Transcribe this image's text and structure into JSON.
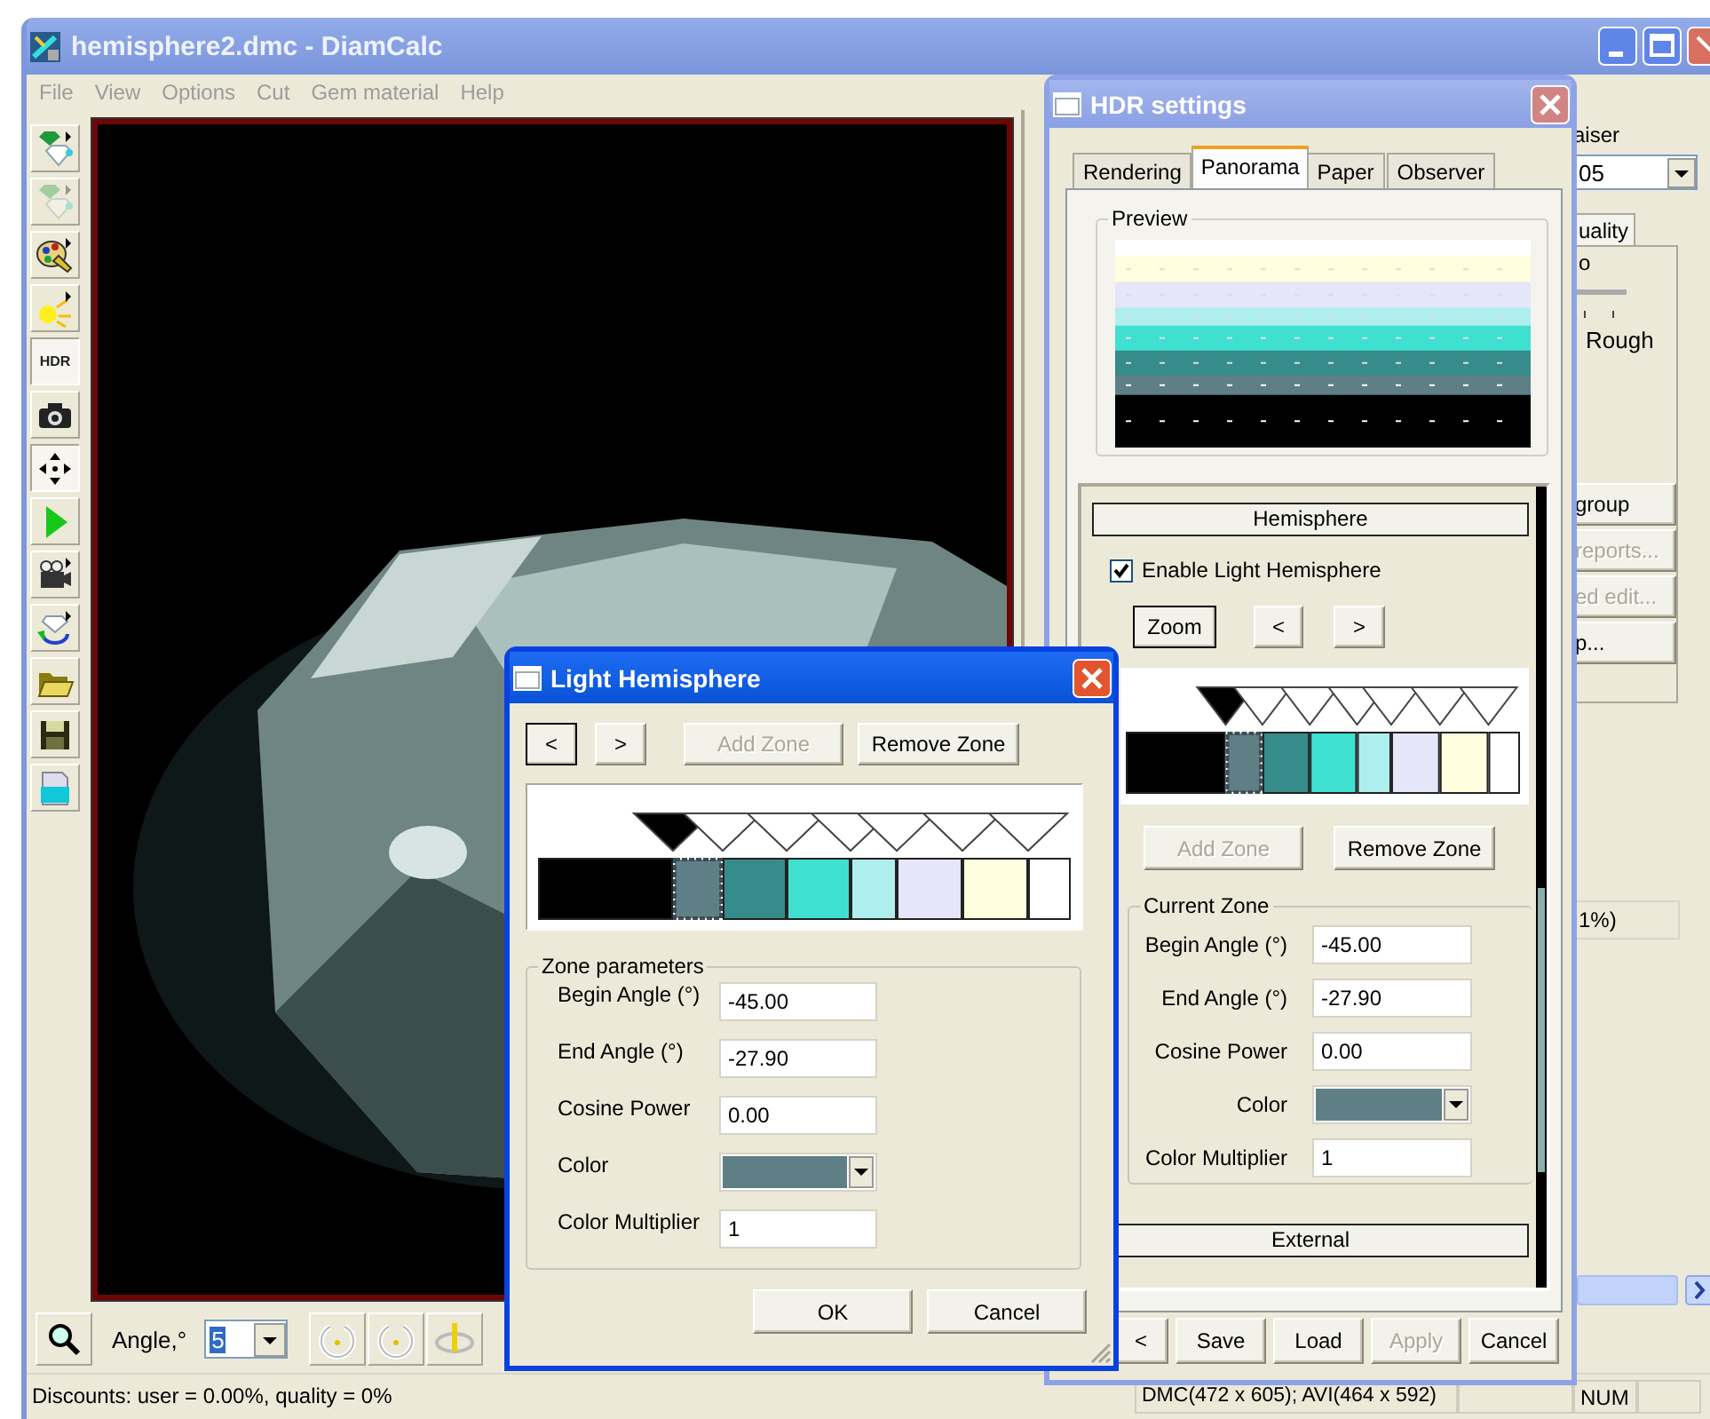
{
  "window": {
    "title": "hemisphere2.dmc - DiamCalc"
  },
  "menu": [
    "File",
    "View",
    "Options",
    "Cut",
    "Gem material",
    "Help"
  ],
  "toolbar": [
    {
      "kind": "gem",
      "pressed": false,
      "disabled": false
    },
    {
      "kind": "gem",
      "pressed": false,
      "disabled": true
    },
    {
      "kind": "palette",
      "pressed": false,
      "disabled": false
    },
    {
      "kind": "lamp",
      "pressed": false,
      "disabled": false
    },
    {
      "kind": "text",
      "label": "HDR",
      "pressed": true,
      "disabled": false
    },
    {
      "kind": "camera",
      "pressed": false,
      "disabled": false
    },
    {
      "kind": "move",
      "pressed": true,
      "disabled": false
    },
    {
      "kind": "play",
      "pressed": false,
      "disabled": false
    },
    {
      "kind": "video",
      "pressed": false,
      "disabled": false
    },
    {
      "kind": "rotate",
      "pressed": false,
      "disabled": false
    },
    {
      "kind": "folder",
      "pressed": false,
      "disabled": false
    },
    {
      "kind": "save",
      "pressed": false,
      "disabled": false
    },
    {
      "kind": "document",
      "pressed": false,
      "disabled": false
    }
  ],
  "side_panel": {
    "label": "aiser",
    "combo_value": "05",
    "tab": {
      "label": "uality",
      "selected": true
    },
    "text": "o",
    "slider_label": "Rough",
    "buttons": [
      {
        "label": "group",
        "disabled": false
      },
      {
        "label": "reports...",
        "disabled": true
      },
      {
        "label": "ed edit...",
        "disabled": true
      },
      {
        "label": "p...",
        "disabled": false
      }
    ],
    "reading": "1%)"
  },
  "bottom_toolbar": {
    "angle_label": "Angle,°",
    "angle_value": "5"
  },
  "status_bar": {
    "message": "Discounts: user = 0.00%, quality = 0%",
    "size": "DMC(472 x 605); AVI(464 x 592)",
    "num": "NUM"
  },
  "hdr_settings": {
    "title": "HDR settings",
    "tabs": [
      {
        "label": "Rendering",
        "selected": false
      },
      {
        "label": "Panorama",
        "selected": true
      },
      {
        "label": "Paper",
        "selected": false
      },
      {
        "label": "Observer",
        "selected": false
      }
    ],
    "preview_label": "Preview",
    "hemisphere_header": "Hemisphere",
    "enable_checkbox": {
      "label": "Enable Light Hemisphere",
      "checked": true
    },
    "zoom_button": "Zoom",
    "prev_button": "<",
    "next_button": ">",
    "zones": [
      {
        "color": "#000000",
        "selected": false
      },
      {
        "color": "#5f7f86",
        "selected": true
      },
      {
        "color": "#368c8b",
        "selected": false
      },
      {
        "color": "#40e0d0",
        "selected": false
      },
      {
        "color": "#afeeee",
        "selected": false
      },
      {
        "color": "#e6e6fa",
        "selected": false
      },
      {
        "color": "#ffffe0",
        "selected": false
      },
      {
        "color": "#ffffff",
        "selected": false
      }
    ],
    "add_zone": {
      "label": "Add Zone",
      "disabled": true
    },
    "remove_zone": {
      "label": "Remove Zone",
      "disabled": false
    },
    "current_zone": {
      "title": "Current Zone",
      "fields": [
        {
          "kind": "text",
          "label": "Begin Angle (°)",
          "value": "-45.00"
        },
        {
          "kind": "text",
          "label": "End Angle (°)",
          "value": "-27.90"
        },
        {
          "kind": "text",
          "label": "Cosine Power",
          "value": "0.00"
        },
        {
          "kind": "color",
          "label": "Color"
        },
        {
          "kind": "text",
          "label": "Color Multiplier",
          "value": "1"
        }
      ]
    },
    "external_header": "External",
    "buttons": [
      {
        "label": "<",
        "disabled": false
      },
      {
        "label": "Save",
        "disabled": false
      },
      {
        "label": "Load",
        "disabled": false
      },
      {
        "label": "Apply",
        "disabled": true
      },
      {
        "label": "Cancel",
        "disabled": false
      }
    ]
  },
  "light_hemisphere": {
    "title": "Light Hemisphere",
    "nav_buttons": [
      {
        "label": "<",
        "disabled": false
      },
      {
        "label": ">",
        "disabled": false
      }
    ],
    "add_zone": {
      "label": "Add Zone",
      "disabled": true
    },
    "remove_zone": {
      "label": "Remove Zone",
      "disabled": false
    },
    "zones": [
      {
        "color": "#000000",
        "selected": false
      },
      {
        "color": "#5f7f86",
        "selected": true
      },
      {
        "color": "#368c8b",
        "selected": false
      },
      {
        "color": "#40e0d0",
        "selected": false
      },
      {
        "color": "#afeeee",
        "selected": false
      },
      {
        "color": "#e6e6fa",
        "selected": false
      },
      {
        "color": "#ffffe0",
        "selected": false
      },
      {
        "color": "#ffffff",
        "selected": false
      }
    ],
    "zone_parameters": {
      "title": "Zone parameters",
      "fields": [
        {
          "kind": "text",
          "label": "Begin Angle (°)",
          "value": "-45.00"
        },
        {
          "kind": "text",
          "label": "End Angle (°)",
          "value": "-27.90"
        },
        {
          "kind": "text",
          "label": "Cosine Power",
          "value": "0.00"
        },
        {
          "kind": "color",
          "label": "Color"
        },
        {
          "kind": "text",
          "label": "Color Multiplier",
          "value": "1"
        }
      ]
    },
    "buttons": [
      {
        "label": "OK",
        "disabled": false
      },
      {
        "label": "Cancel",
        "disabled": false
      }
    ]
  }
}
